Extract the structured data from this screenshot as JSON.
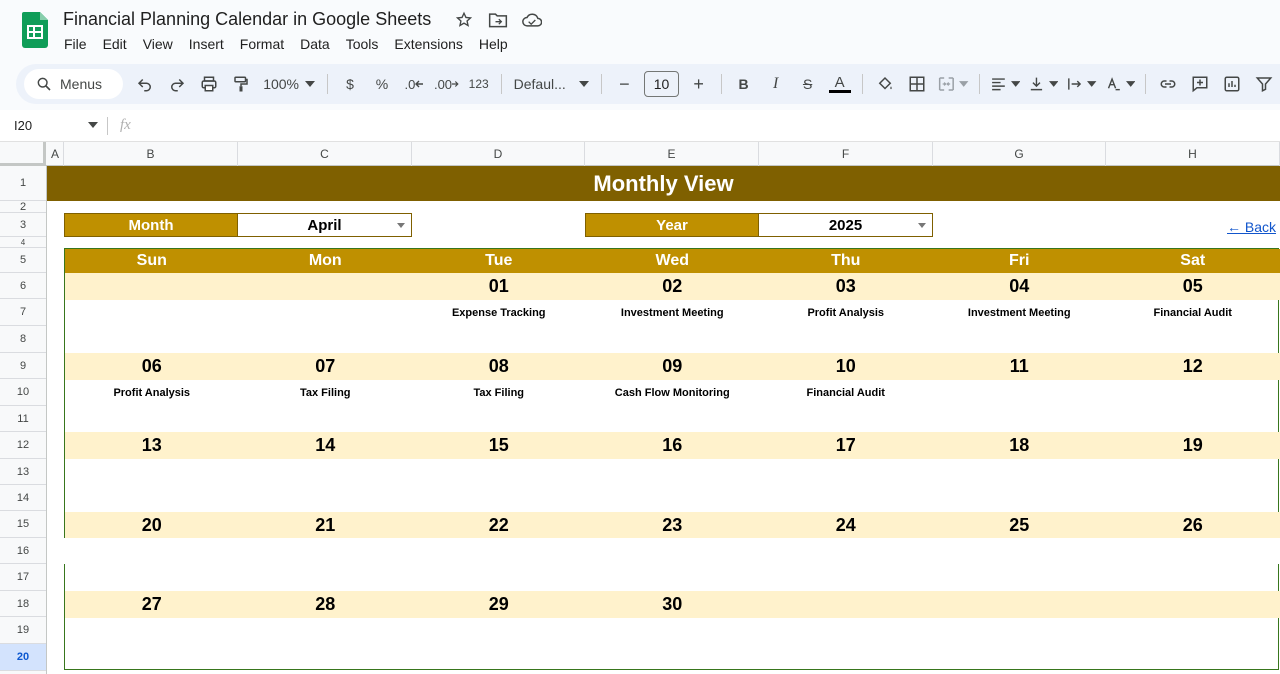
{
  "document": {
    "title": "Financial Planning Calendar in Google Sheets"
  },
  "menu": [
    "File",
    "Edit",
    "View",
    "Insert",
    "Format",
    "Data",
    "Tools",
    "Extensions",
    "Help"
  ],
  "toolbar": {
    "search_label": "Menus",
    "zoom": "100%",
    "currency": "$",
    "percent": "%",
    "decrease_decimal": ".0",
    "increase_decimal": ".00",
    "number_format": "123",
    "font": "Defaul...",
    "font_size": "10",
    "bold": "B",
    "italic": "I",
    "strike": "S",
    "text_color": "A",
    "minus": "−",
    "plus": "+"
  },
  "formula_bar": {
    "cell_ref": "I20",
    "fx": "fx"
  },
  "columns": [
    "A",
    "B",
    "C",
    "D",
    "E",
    "F",
    "G",
    "H"
  ],
  "rows": [
    "1",
    "2",
    "3",
    "4",
    "5",
    "6",
    "7",
    "8",
    "9",
    "10",
    "11",
    "12",
    "13",
    "14",
    "15",
    "16",
    "17",
    "18",
    "19",
    "20"
  ],
  "active_row": "20",
  "calendar": {
    "title": "Monthly View",
    "month_label": "Month",
    "month_value": "April",
    "year_label": "Year",
    "year_value": "2025",
    "back_link": "← Back",
    "days": [
      "Sun",
      "Mon",
      "Tue",
      "Wed",
      "Thu",
      "Fri",
      "Sat"
    ],
    "weeks": [
      {
        "dates": [
          "",
          "",
          "01",
          "02",
          "03",
          "04",
          "05"
        ],
        "events": [
          "",
          "",
          "Expense Tracking",
          "Investment Meeting",
          "Profit Analysis",
          "Investment Meeting",
          "Financial Audit"
        ]
      },
      {
        "dates": [
          "06",
          "07",
          "08",
          "09",
          "10",
          "11",
          "12"
        ],
        "events": [
          "Profit Analysis",
          "Tax Filing",
          "Tax Filing",
          "Cash Flow Monitoring",
          "Financial Audit",
          "",
          ""
        ]
      },
      {
        "dates": [
          "13",
          "14",
          "15",
          "16",
          "17",
          "18",
          "19"
        ],
        "events": [
          "",
          "",
          "",
          "",
          "",
          "",
          ""
        ]
      },
      {
        "dates": [
          "20",
          "21",
          "22",
          "23",
          "24",
          "25",
          "26"
        ],
        "events": [
          "",
          "",
          "",
          "",
          "",
          "",
          ""
        ]
      },
      {
        "dates": [
          "27",
          "28",
          "29",
          "30",
          "",
          "",
          ""
        ],
        "events": [
          "",
          "",
          "",
          "",
          "",
          "",
          ""
        ]
      }
    ]
  },
  "colors": {
    "banner": "#7f6000",
    "header": "#bf9000",
    "date_row": "#fff2cc",
    "border": "#38761d",
    "link": "#1155cc"
  }
}
